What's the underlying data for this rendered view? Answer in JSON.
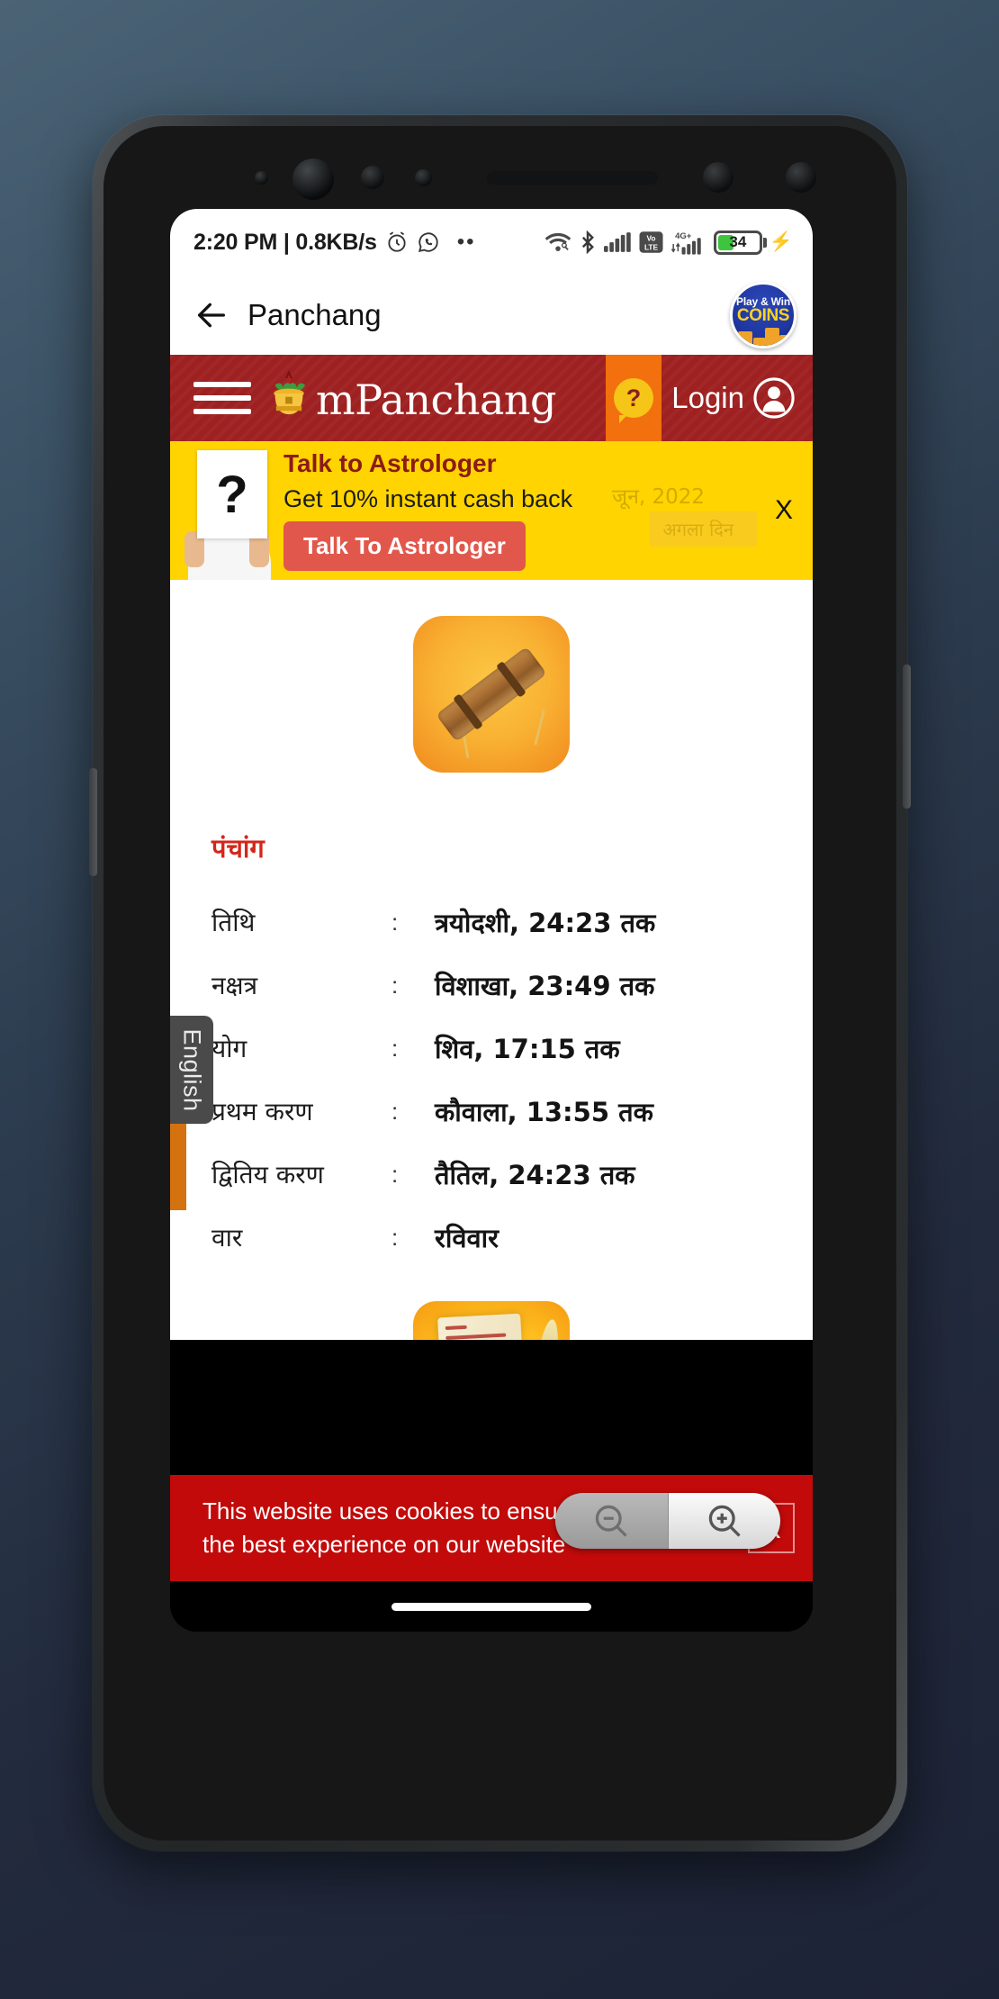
{
  "status_bar": {
    "time": "2:20 PM | 0.8KB/s",
    "icons": [
      "alarm-icon",
      "whatsapp-icon",
      "more-dots-icon"
    ],
    "right_icons": [
      "wifi-icon",
      "bluetooth-icon",
      "signal-icon",
      "volte-icon",
      "network-4gplus-icon"
    ],
    "network_label": "4G+",
    "volte_label": "VoLTE",
    "battery_level": "34",
    "battery_percent": 34,
    "charging": true
  },
  "app_bar": {
    "back_label": "back-arrow",
    "title": "Panchang",
    "coins_badge": {
      "line1": "Play & Win",
      "line2": "COINS"
    }
  },
  "site_header": {
    "menu_label": "menu",
    "logo_text": "mPanchang",
    "help_label": "?",
    "login_label": "Login"
  },
  "ad_banner": {
    "card_glyph": "?",
    "title": "Talk to Astrologer",
    "subtitle": "Get 10% instant cash back",
    "cta": "Talk To Astrologer",
    "close_label": "X",
    "ghost_date": "जून, 2022",
    "ghost_button": "अगला दिन",
    "bg_color": "#ffd400"
  },
  "content": {
    "scroll_icon_name": "rolled-scroll-icon",
    "heading": "पंचांग",
    "heading_color": "#d4261b",
    "rows": [
      {
        "label": "तिथि",
        "separator": ":",
        "value": "त्रयोदशी, 24:23 तक"
      },
      {
        "label": "नक्षत्र",
        "separator": ":",
        "value": "विशाखा, 23:49 तक"
      },
      {
        "label": "योग",
        "separator": ":",
        "value": "शिव, 17:15 तक"
      },
      {
        "label": "प्रथम करण",
        "separator": ":",
        "value": "कौवाला, 13:55 तक"
      },
      {
        "label": "द्वितिय करण",
        "separator": ":",
        "value": "तैतिल, 24:23 तक"
      },
      {
        "label": "वार",
        "separator": ":",
        "value": "रविवार"
      }
    ],
    "language_tab": "English",
    "open_scroll_icon_name": "open-scroll-quill-icon"
  },
  "cookie_banner": {
    "text": "This website uses cookies to ensure you get the best experience on our website",
    "close_label": "X",
    "bg_color": "#c20a0a"
  },
  "zoom_controls": {
    "zoom_out_label": "zoom-out-icon",
    "zoom_in_label": "zoom-in-icon"
  }
}
